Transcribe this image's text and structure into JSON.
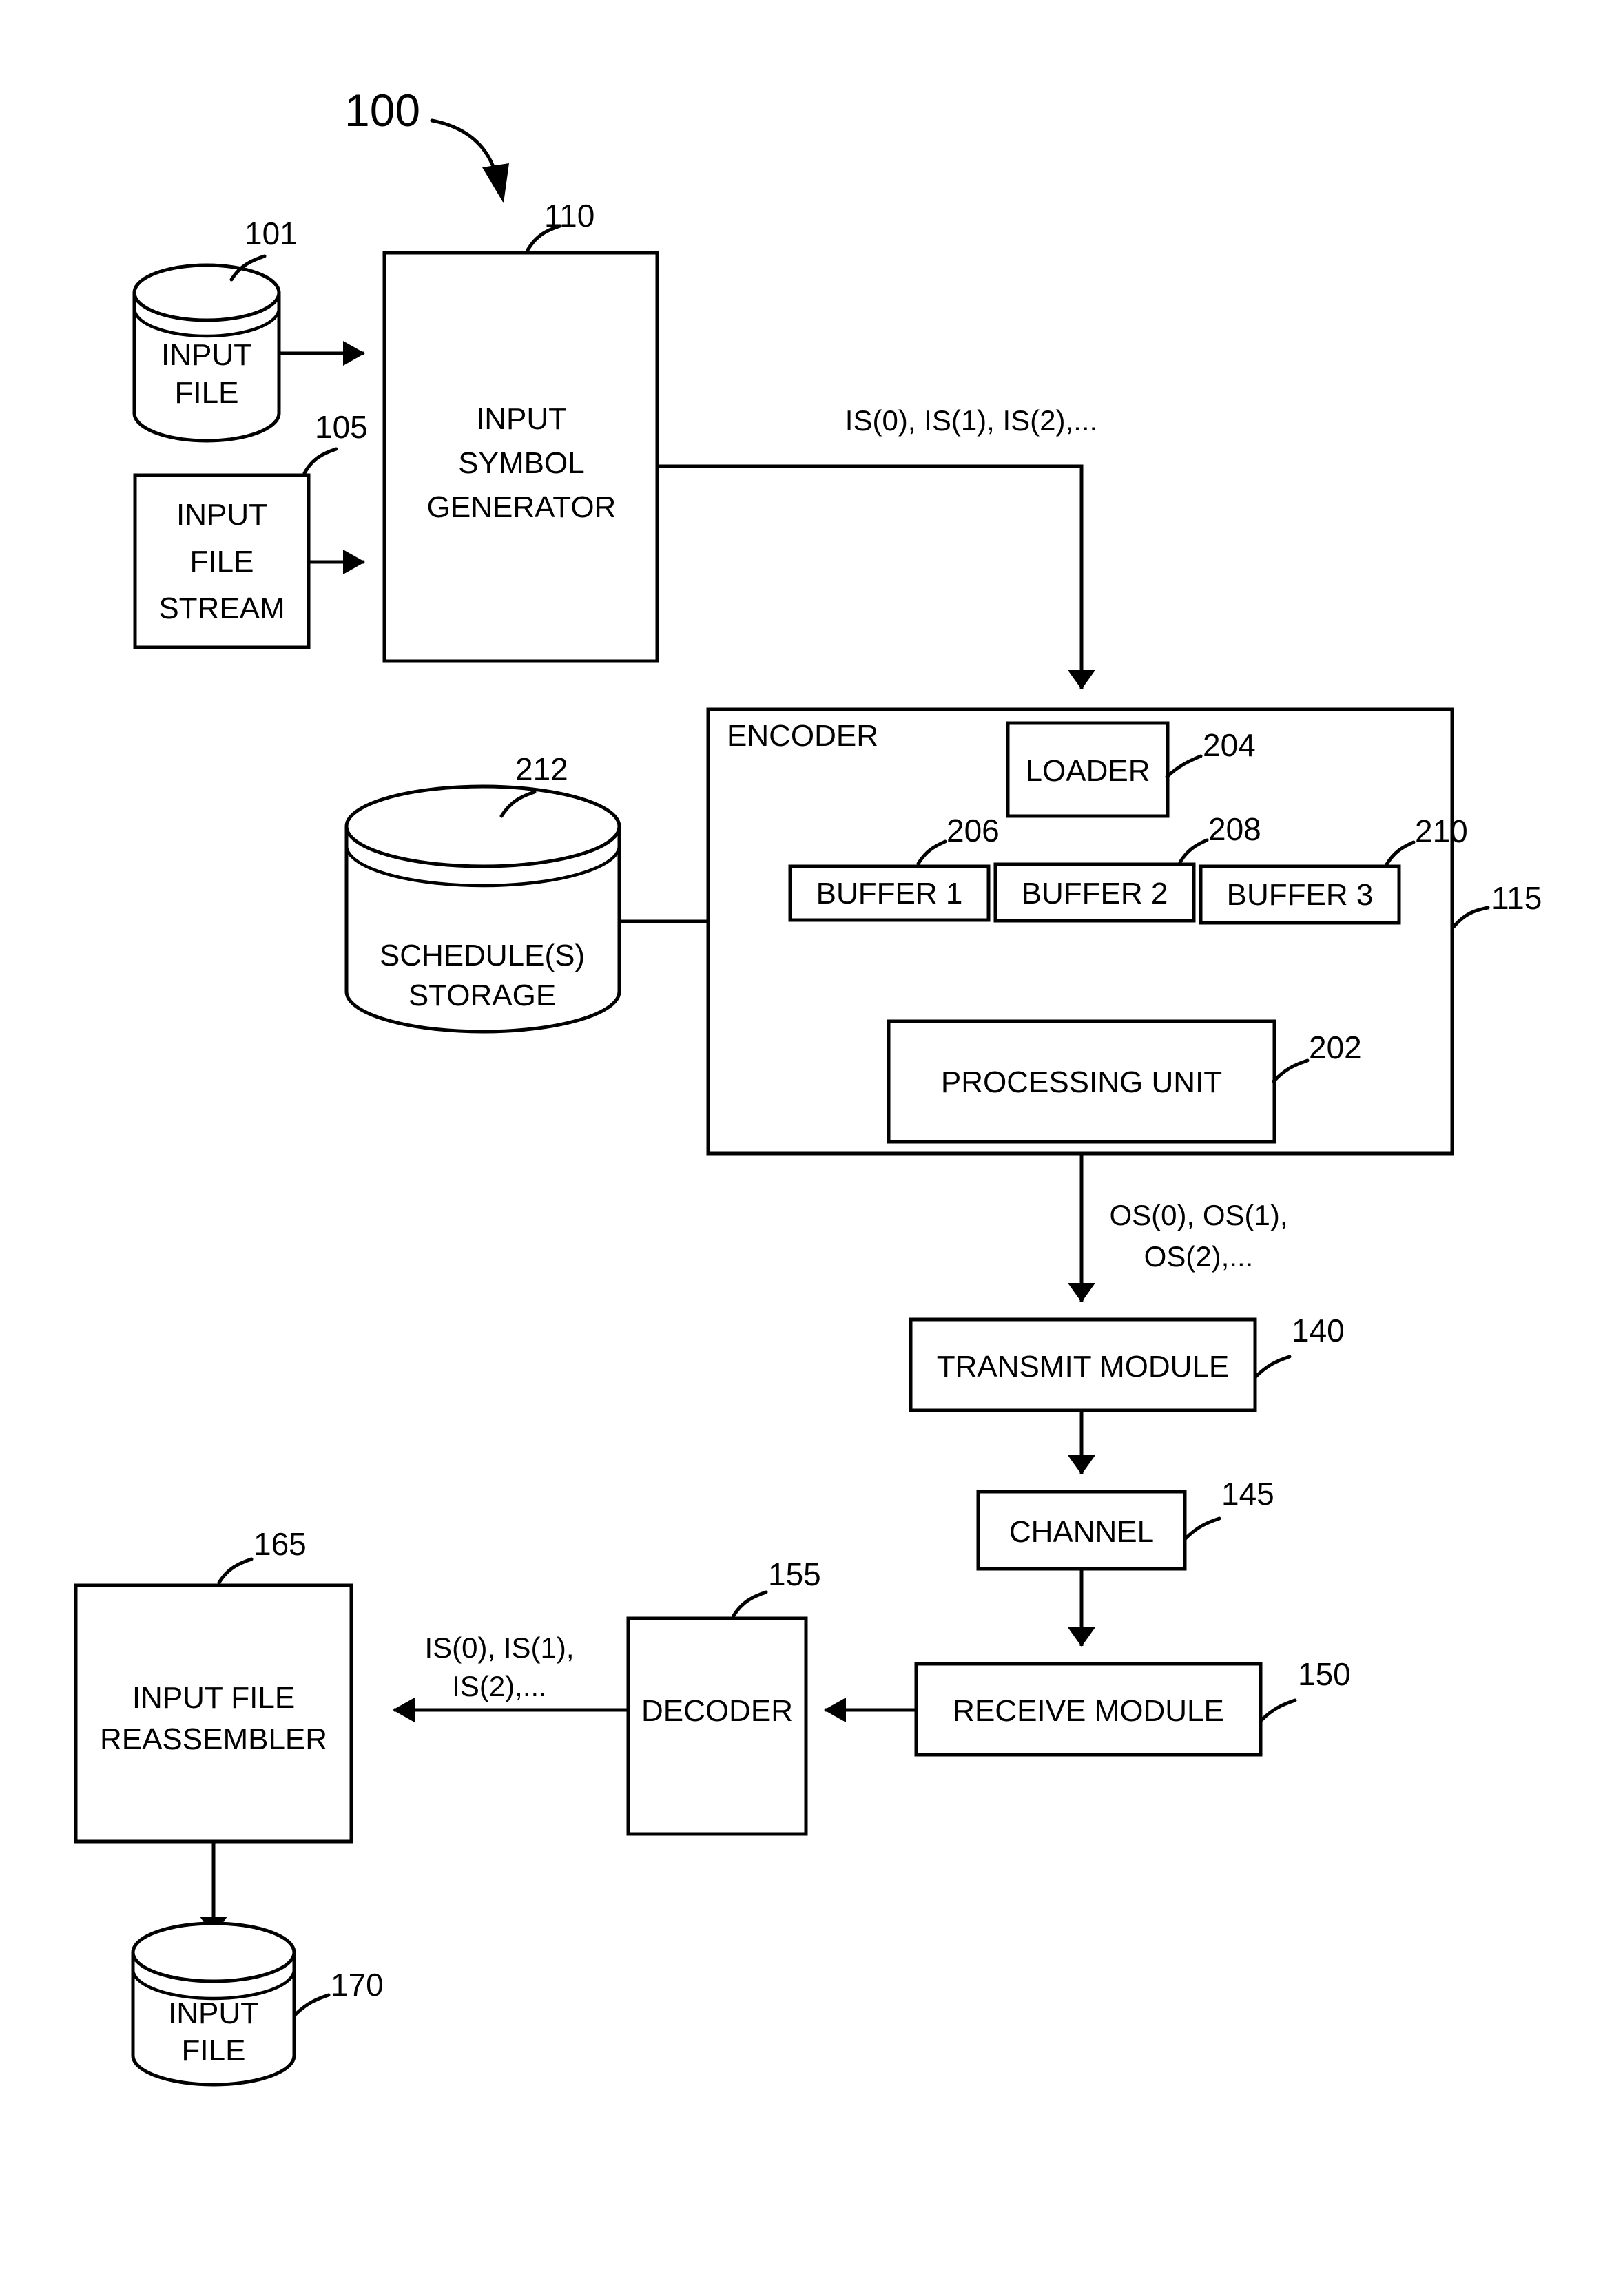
{
  "figure": {
    "number": "100",
    "type": "system-block-diagram"
  },
  "nodes": {
    "input_file_top": {
      "label_line1": "INPUT",
      "label_line2": "FILE",
      "ref": "101",
      "shape": "cylinder"
    },
    "input_file_stream": {
      "label_line1": "INPUT",
      "label_line2": "FILE",
      "label_line3": "STREAM",
      "ref": "105",
      "shape": "rect"
    },
    "input_symbol_generator": {
      "label_line1": "INPUT",
      "label_line2": "SYMBOL",
      "label_line3": "GENERATOR",
      "ref": "110",
      "shape": "rect"
    },
    "encoder": {
      "label": "ENCODER",
      "ref": "115",
      "shape": "rect"
    },
    "loader": {
      "label": "LOADER",
      "ref": "204",
      "shape": "rect"
    },
    "buffer1": {
      "label": "BUFFER 1",
      "ref": "206",
      "shape": "rect"
    },
    "buffer2": {
      "label": "BUFFER 2",
      "ref": "208",
      "shape": "rect"
    },
    "buffer3": {
      "label": "BUFFER 3",
      "ref": "210",
      "shape": "rect"
    },
    "processing_unit": {
      "label": "PROCESSING UNIT",
      "ref": "202",
      "shape": "rect"
    },
    "schedules_storage": {
      "label_line1": "SCHEDULE(S)",
      "label_line2": "STORAGE",
      "ref": "212",
      "shape": "cylinder"
    },
    "transmit_module": {
      "label": "TRANSMIT MODULE",
      "ref": "140",
      "shape": "rect"
    },
    "channel": {
      "label": "CHANNEL",
      "ref": "145",
      "shape": "rect"
    },
    "receive_module": {
      "label": "RECEIVE MODULE",
      "ref": "150",
      "shape": "rect"
    },
    "decoder": {
      "label": "DECODER",
      "ref": "155",
      "shape": "rect"
    },
    "input_file_reassembler": {
      "label_line1": "INPUT FILE",
      "label_line2": "REASSEMBLER",
      "ref": "165",
      "shape": "rect"
    },
    "input_file_bottom": {
      "label_line1": "INPUT",
      "label_line2": "FILE",
      "ref": "170",
      "shape": "cylinder"
    }
  },
  "flow_labels": {
    "input_symbols_top": "IS(0), IS(1), IS(2),...",
    "output_symbols_line1": "OS(0), OS(1),",
    "output_symbols_line2": "OS(2),...",
    "input_symbols_bottom_line1": "IS(0), IS(1),",
    "input_symbols_bottom_line2": "IS(2),..."
  },
  "colors": {
    "line": "#000000",
    "background": "#ffffff",
    "text": "#000000"
  }
}
